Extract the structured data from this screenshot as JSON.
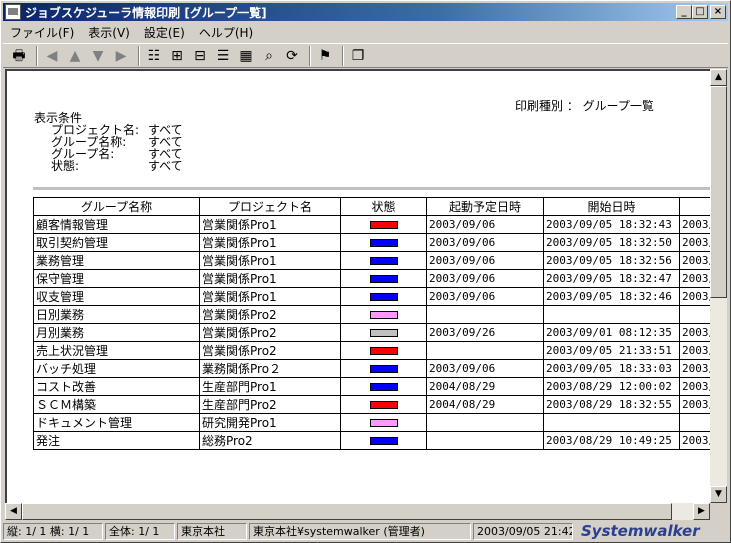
{
  "window": {
    "title": "ジョブスケジューラ情報印刷 [グループ一覧]",
    "buttons": {
      "minimize": "_",
      "maximize": "□",
      "close": "×"
    }
  },
  "menu": [
    "ファイル(F)",
    "表示(V)",
    "設定(E)",
    "ヘルプ(H)"
  ],
  "toolbar": {
    "icons": [
      "print-icon",
      "arrow-left-icon",
      "arrow-up-icon",
      "arrow-down-icon",
      "arrow-right-icon",
      "tree-view-icon",
      "tree-expand-icon",
      "tree-collapse-icon",
      "list-view-icon",
      "detail-view-icon",
      "search-icon",
      "refresh-icon",
      "stamp-icon",
      "window-icon"
    ]
  },
  "report": {
    "print_type_label": "印刷種別 ： グループ一覧",
    "condition_title": "表示条件",
    "conditions": [
      {
        "key": "プロジェクト名:",
        "value": "すべて"
      },
      {
        "key": "グループ名称:",
        "value": "すべて"
      },
      {
        "key": "グループ名:",
        "value": "すべて"
      },
      {
        "key": "状態:",
        "value": "すべて"
      }
    ],
    "columns": [
      "グループ名称",
      "プロジェクト名",
      "状態",
      "起動予定日時",
      "開始日時",
      ""
    ],
    "rows": [
      {
        "name": "顧客情報管理",
        "project": "営業関係Pro1",
        "status_color": "#ff0000",
        "scheduled": "2003/09/06",
        "start": "2003/09/05 18:32:43",
        "extra": "2003/"
      },
      {
        "name": "取引契約管理",
        "project": "営業関係Pro1",
        "status_color": "#0000ff",
        "scheduled": "2003/09/06",
        "start": "2003/09/05 18:32:50",
        "extra": "2003/"
      },
      {
        "name": "業務管理",
        "project": "営業関係Pro1",
        "status_color": "#0000ff",
        "scheduled": "2003/09/06",
        "start": "2003/09/05 18:32:56",
        "extra": "2003/"
      },
      {
        "name": "保守管理",
        "project": "営業関係Pro1",
        "status_color": "#0000ff",
        "scheduled": "2003/09/06",
        "start": "2003/09/05 18:32:47",
        "extra": "2003/"
      },
      {
        "name": "収支管理",
        "project": "営業関係Pro1",
        "status_color": "#0000ff",
        "scheduled": "2003/09/06",
        "start": "2003/09/05 18:32:46",
        "extra": "2003/"
      },
      {
        "name": "日別業務",
        "project": "営業関係Pro2",
        "status_color": "#ff99ff",
        "scheduled": "",
        "start": "",
        "extra": ""
      },
      {
        "name": "月別業務",
        "project": "営業関係Pro2",
        "status_color": "#c0c0c0",
        "scheduled": "2003/09/26",
        "start": "2003/09/01 08:12:35",
        "extra": "2003/"
      },
      {
        "name": "売上状況管理",
        "project": "営業関係Pro2",
        "status_color": "#ff0000",
        "scheduled": "",
        "start": "2003/09/05 21:33:51",
        "extra": "2003/"
      },
      {
        "name": "バッチ処理",
        "project": "業務関係Pro２",
        "status_color": "#0000ff",
        "scheduled": "2003/09/06",
        "start": "2003/09/05 18:33:03",
        "extra": "2003/"
      },
      {
        "name": "コスト改善",
        "project": "生産部門Pro1",
        "status_color": "#0000ff",
        "scheduled": "2004/08/29",
        "start": "2003/08/29 12:00:02",
        "extra": "2003/"
      },
      {
        "name": "ＳＣＭ構築",
        "project": "生産部門Pro2",
        "status_color": "#ff0000",
        "scheduled": "2004/08/29",
        "start": "2003/08/29 18:32:55",
        "extra": "2003/"
      },
      {
        "name": "ドキュメント管理",
        "project": "研究開発Pro1",
        "status_color": "#ff99ff",
        "scheduled": "",
        "start": "",
        "extra": ""
      },
      {
        "name": "発注",
        "project": "総務Pro2",
        "status_color": "#0000ff",
        "scheduled": "",
        "start": "2003/08/29 10:49:25",
        "extra": "2003/"
      }
    ]
  },
  "statusbar": {
    "page": "縦: 1/ 1 横: 1/ 1",
    "total": "全体: 1/ 1",
    "server": "東京本社",
    "user": "東京本社¥systemwalker (管理者)",
    "datetime": "2003/09/05 21:42",
    "logo": "Systemwalker"
  }
}
